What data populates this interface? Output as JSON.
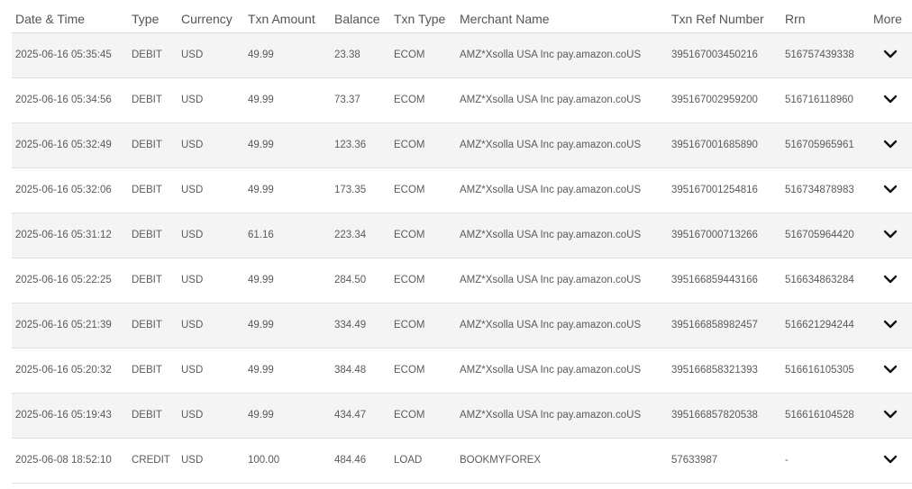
{
  "columns": [
    "Date & Time",
    "Type",
    "Currency",
    "Txn Amount",
    "Balance",
    "Txn Type",
    "Merchant Name",
    "Txn Ref Number",
    "Rrn",
    "More"
  ],
  "rows": [
    {
      "datetime": "2025-06-16 05:35:45",
      "type": "DEBIT",
      "currency": "USD",
      "amount": "49.99",
      "balance": "23.38",
      "txn_type": "ECOM",
      "merchant": "AMZ*Xsolla USA Inc pay.amazon.coUS",
      "ref": "395167003450216",
      "rrn": "516757439338"
    },
    {
      "datetime": "2025-06-16 05:34:56",
      "type": "DEBIT",
      "currency": "USD",
      "amount": "49.99",
      "balance": "73.37",
      "txn_type": "ECOM",
      "merchant": "AMZ*Xsolla USA Inc pay.amazon.coUS",
      "ref": "395167002959200",
      "rrn": "516716118960"
    },
    {
      "datetime": "2025-06-16 05:32:49",
      "type": "DEBIT",
      "currency": "USD",
      "amount": "49.99",
      "balance": "123.36",
      "txn_type": "ECOM",
      "merchant": "AMZ*Xsolla USA Inc pay.amazon.coUS",
      "ref": "395167001685890",
      "rrn": "516705965961"
    },
    {
      "datetime": "2025-06-16 05:32:06",
      "type": "DEBIT",
      "currency": "USD",
      "amount": "49.99",
      "balance": "173.35",
      "txn_type": "ECOM",
      "merchant": "AMZ*Xsolla USA Inc pay.amazon.coUS",
      "ref": "395167001254816",
      "rrn": "516734878983"
    },
    {
      "datetime": "2025-06-16 05:31:12",
      "type": "DEBIT",
      "currency": "USD",
      "amount": "61.16",
      "balance": "223.34",
      "txn_type": "ECOM",
      "merchant": "AMZ*Xsolla USA Inc pay.amazon.coUS",
      "ref": "395167000713266",
      "rrn": "516705964420"
    },
    {
      "datetime": "2025-06-16 05:22:25",
      "type": "DEBIT",
      "currency": "USD",
      "amount": "49.99",
      "balance": "284.50",
      "txn_type": "ECOM",
      "merchant": "AMZ*Xsolla USA Inc pay.amazon.coUS",
      "ref": "395166859443166",
      "rrn": "516634863284"
    },
    {
      "datetime": "2025-06-16 05:21:39",
      "type": "DEBIT",
      "currency": "USD",
      "amount": "49.99",
      "balance": "334.49",
      "txn_type": "ECOM",
      "merchant": "AMZ*Xsolla USA Inc pay.amazon.coUS",
      "ref": "395166858982457",
      "rrn": "516621294244"
    },
    {
      "datetime": "2025-06-16 05:20:32",
      "type": "DEBIT",
      "currency": "USD",
      "amount": "49.99",
      "balance": "384.48",
      "txn_type": "ECOM",
      "merchant": "AMZ*Xsolla USA Inc pay.amazon.coUS",
      "ref": "395166858321393",
      "rrn": "516616105305"
    },
    {
      "datetime": "2025-06-16 05:19:43",
      "type": "DEBIT",
      "currency": "USD",
      "amount": "49.99",
      "balance": "434.47",
      "txn_type": "ECOM",
      "merchant": "AMZ*Xsolla USA Inc pay.amazon.coUS",
      "ref": "395166857820538",
      "rrn": "516616104528"
    },
    {
      "datetime": "2025-06-08 18:52:10",
      "type": "CREDIT",
      "currency": "USD",
      "amount": "100.00",
      "balance": "484.46",
      "txn_type": "LOAD",
      "merchant": "BOOKMYFOREX",
      "ref": "57633987",
      "rrn": "-"
    }
  ],
  "icons": {
    "expand": "chevron-down-icon"
  },
  "colors": {
    "text": "#555555",
    "alt_row": "#f4f4f4",
    "border": "#e2e2e2"
  }
}
